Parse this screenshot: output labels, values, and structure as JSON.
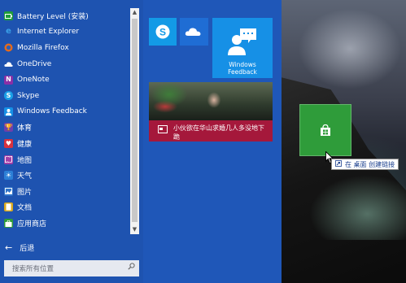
{
  "start_menu": {
    "apps": [
      {
        "label": "Battery Level (安装)",
        "icon": "battery-icon",
        "color": "#1f9e3a"
      },
      {
        "label": "Internet Explorer",
        "icon": "internet-explorer-icon",
        "color": "#3aa0e8"
      },
      {
        "label": "Mozilla Firefox",
        "icon": "firefox-icon",
        "color": "#e66a1b"
      },
      {
        "label": "OneDrive",
        "icon": "onedrive-icon",
        "color": "#ffffff"
      },
      {
        "label": "OneNote",
        "icon": "onenote-icon",
        "color": "#8a2fa6"
      },
      {
        "label": "Skype",
        "icon": "skype-icon",
        "color": "#1b9fe6"
      },
      {
        "label": "Windows Feedback",
        "icon": "feedback-icon",
        "color": "#1690e6"
      },
      {
        "label": "体育",
        "icon": "trophy-icon",
        "color": "#6d3fae"
      },
      {
        "label": "健康",
        "icon": "heart-icon",
        "color": "#d8323e"
      },
      {
        "label": "地图",
        "icon": "map-icon",
        "color": "#a23ea8"
      },
      {
        "label": "天气",
        "icon": "sun-icon",
        "color": "#2c7fd6"
      },
      {
        "label": "图片",
        "icon": "picture-icon",
        "color": "#2f73c8"
      },
      {
        "label": "文档",
        "icon": "document-icon",
        "color": "#d8a81e"
      },
      {
        "label": "应用商店",
        "icon": "store-icon",
        "color": "#2f9c3a"
      }
    ],
    "back_label": "后退",
    "search_placeholder": "搜索所有位置"
  },
  "tiles": {
    "feedback_label_line1": "Windows",
    "feedback_label_line2": "Feedback",
    "news_text": "小伙欲在华山求婚几人多没地下跪"
  },
  "drag": {
    "tooltip_text": "在 桌面 创建链接"
  },
  "colors": {
    "start_bg": "#1f57b8",
    "accent_blue": "#1690e6",
    "news_red": "#a5183b",
    "store_green": "#2f9c3a"
  }
}
